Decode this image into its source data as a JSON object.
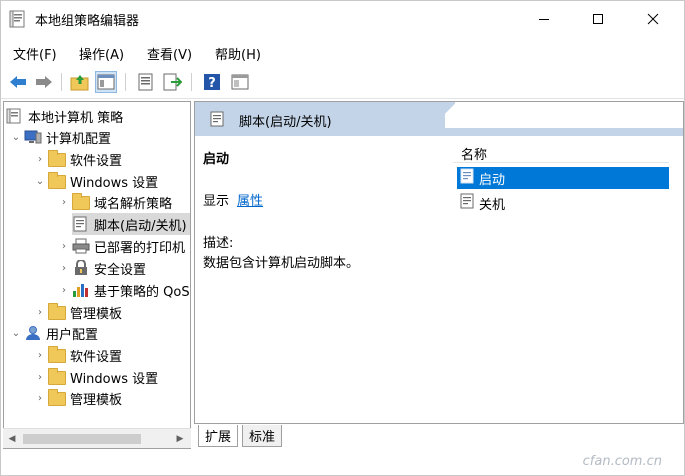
{
  "window": {
    "title": "本地组策略编辑器"
  },
  "menubar": {
    "items": [
      {
        "label": "文件(F)"
      },
      {
        "label": "操作(A)"
      },
      {
        "label": "查看(V)"
      },
      {
        "label": "帮助(H)"
      }
    ]
  },
  "toolbar": {
    "buttons": [
      "back-icon",
      "forward-icon",
      "up-folder-icon",
      "show-hide-tree-icon",
      "properties-icon",
      "export-list-icon",
      "help-icon",
      "extended-view-icon"
    ]
  },
  "tree": {
    "root": "本地计算机 策略",
    "computer_config": "计算机配置",
    "software_settings": "软件设置",
    "windows_settings": "Windows 设置",
    "name_resolution_policy": "域名解析策略",
    "scripts": "脚本(启动/关机)",
    "deployed_printers": "已部署的打印机",
    "security_settings": "安全设置",
    "policy_qos": "基于策略的 QoS",
    "admin_templates": "管理模板",
    "user_config": "用户配置",
    "user_software_settings": "软件设置",
    "user_windows_settings": "Windows 设置",
    "user_admin_templates": "管理模板"
  },
  "right_pane": {
    "header": "脚本(启动/关机)",
    "extended_title": "启动",
    "show_label": "显示",
    "properties_link": "属性",
    "description_label": "描述:",
    "description_text": "数据包含计算机启动脚本。",
    "column_name": "名称",
    "items": [
      {
        "label": "启动",
        "selected": true
      },
      {
        "label": "关机",
        "selected": false
      }
    ]
  },
  "tabs": [
    {
      "label": "扩展",
      "active": true
    },
    {
      "label": "标准",
      "active": false
    }
  ],
  "watermark": "cfan.com.cn",
  "colors": {
    "selection": "#0078d7",
    "header_band": "#c4d4e8",
    "link": "#0066cc"
  }
}
